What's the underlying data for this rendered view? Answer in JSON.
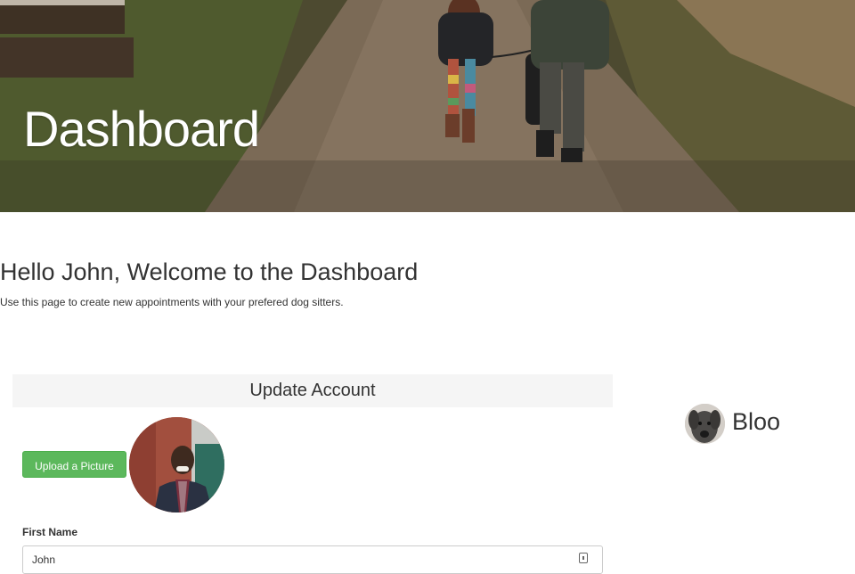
{
  "hero": {
    "title": "Dashboard"
  },
  "welcome": {
    "heading": "Hello John, Welcome to the Dashboard",
    "subtext": "Use this page to create new appointments with your prefered dog sitters."
  },
  "account": {
    "panel_title": "Update Account",
    "upload_label": "Upload a Picture",
    "first_name_label": "First Name",
    "first_name_value": "John"
  },
  "dog": {
    "name": "Bloo"
  },
  "colors": {
    "upload_button": "#5cb85c",
    "panel_header_bg": "#f5f5f5"
  }
}
